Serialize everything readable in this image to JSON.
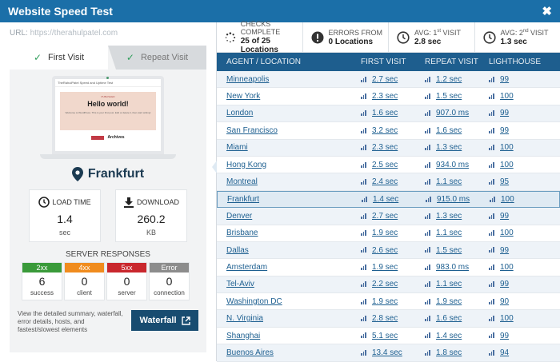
{
  "window": {
    "title": "Website Speed Test",
    "close": "✖"
  },
  "url": {
    "label": "URL:",
    "value": "https://therahulpatel.com"
  },
  "tabs": {
    "first": "First Visit",
    "repeat": "Repeat Visit"
  },
  "preview": {
    "site_title": "TheRahulPatel Speed and Uptime Test",
    "published": "PUBLISHED",
    "heading": "Hello world!",
    "body": "Welcome to WordPress. This is your first post. Edit or delete it, then start writing!",
    "archives": "Archives"
  },
  "location": "Frankfurt",
  "load_time": {
    "label": "LOAD TIME",
    "value": "1.4",
    "unit": "sec"
  },
  "download": {
    "label": "DOWNLOAD",
    "value": "260.2",
    "unit": "KB"
  },
  "server_responses": {
    "title": "SERVER RESPONSES",
    "codes": [
      {
        "code": "2xx",
        "count": "6",
        "label": "success",
        "color": "#3a9a3a"
      },
      {
        "code": "4xx",
        "count": "0",
        "label": "client",
        "color": "#f08c1e"
      },
      {
        "code": "5xx",
        "count": "0",
        "label": "server",
        "color": "#c9272d"
      },
      {
        "code": "Error",
        "count": "0",
        "label": "connection",
        "color": "#8c8c8c"
      }
    ]
  },
  "bottom": {
    "desc": "View the detailed summary, waterfall, error details, hosts, and fastest/slowest elements",
    "waterfall": "Waterfall"
  },
  "stats": [
    {
      "label": "CHECKS COMPLETE",
      "value": "25 of 25 Locations",
      "icon": "spinner-icon"
    },
    {
      "label": "ERRORS FROM",
      "value": "0 Locations",
      "icon": "error-icon"
    },
    {
      "label_pre": "AVG: 1",
      "label_sup": "st",
      "label_post": " VISIT",
      "value": "2.8 sec",
      "icon": "clock-icon"
    },
    {
      "label_pre": "AVG: 2",
      "label_sup": "nd",
      "label_post": " VISIT",
      "value": "1.3 sec",
      "icon": "clock-icon"
    }
  ],
  "table": {
    "headers": [
      "AGENT / LOCATION",
      "FIRST VISIT",
      "REPEAT VISIT",
      "LIGHTHOUSE"
    ],
    "rows": [
      [
        "Minneapolis",
        "2.7 sec",
        "1.2 sec",
        "99"
      ],
      [
        "New York",
        "2.3 sec",
        "1.5 sec",
        "100"
      ],
      [
        "London",
        "1.6 sec",
        "907.0 ms",
        "99"
      ],
      [
        "San Francisco",
        "3.2 sec",
        "1.6 sec",
        "99"
      ],
      [
        "Miami",
        "2.3 sec",
        "1.3 sec",
        "100"
      ],
      [
        "Hong Kong",
        "2.5 sec",
        "934.0 ms",
        "100"
      ],
      [
        "Montreal",
        "2.4 sec",
        "1.1 sec",
        "95"
      ],
      [
        "Frankfurt",
        "1.4 sec",
        "915.0 ms",
        "100"
      ],
      [
        "Denver",
        "2.7 sec",
        "1.3 sec",
        "99"
      ],
      [
        "Brisbane",
        "1.9 sec",
        "1.1 sec",
        "100"
      ],
      [
        "Dallas",
        "2.6 sec",
        "1.5 sec",
        "99"
      ],
      [
        "Amsterdam",
        "1.9 sec",
        "983.0 ms",
        "100"
      ],
      [
        "Tel-Aviv",
        "2.2 sec",
        "1.1 sec",
        "99"
      ],
      [
        "Washington DC",
        "1.9 sec",
        "1.9 sec",
        "90"
      ],
      [
        "N. Virginia",
        "2.8 sec",
        "1.6 sec",
        "100"
      ],
      [
        "Shanghai",
        "5.1 sec",
        "1.4 sec",
        "99"
      ],
      [
        "Buenos Aires",
        "13.4 sec",
        "1.8 sec",
        "94"
      ]
    ],
    "selected_index": 7
  }
}
